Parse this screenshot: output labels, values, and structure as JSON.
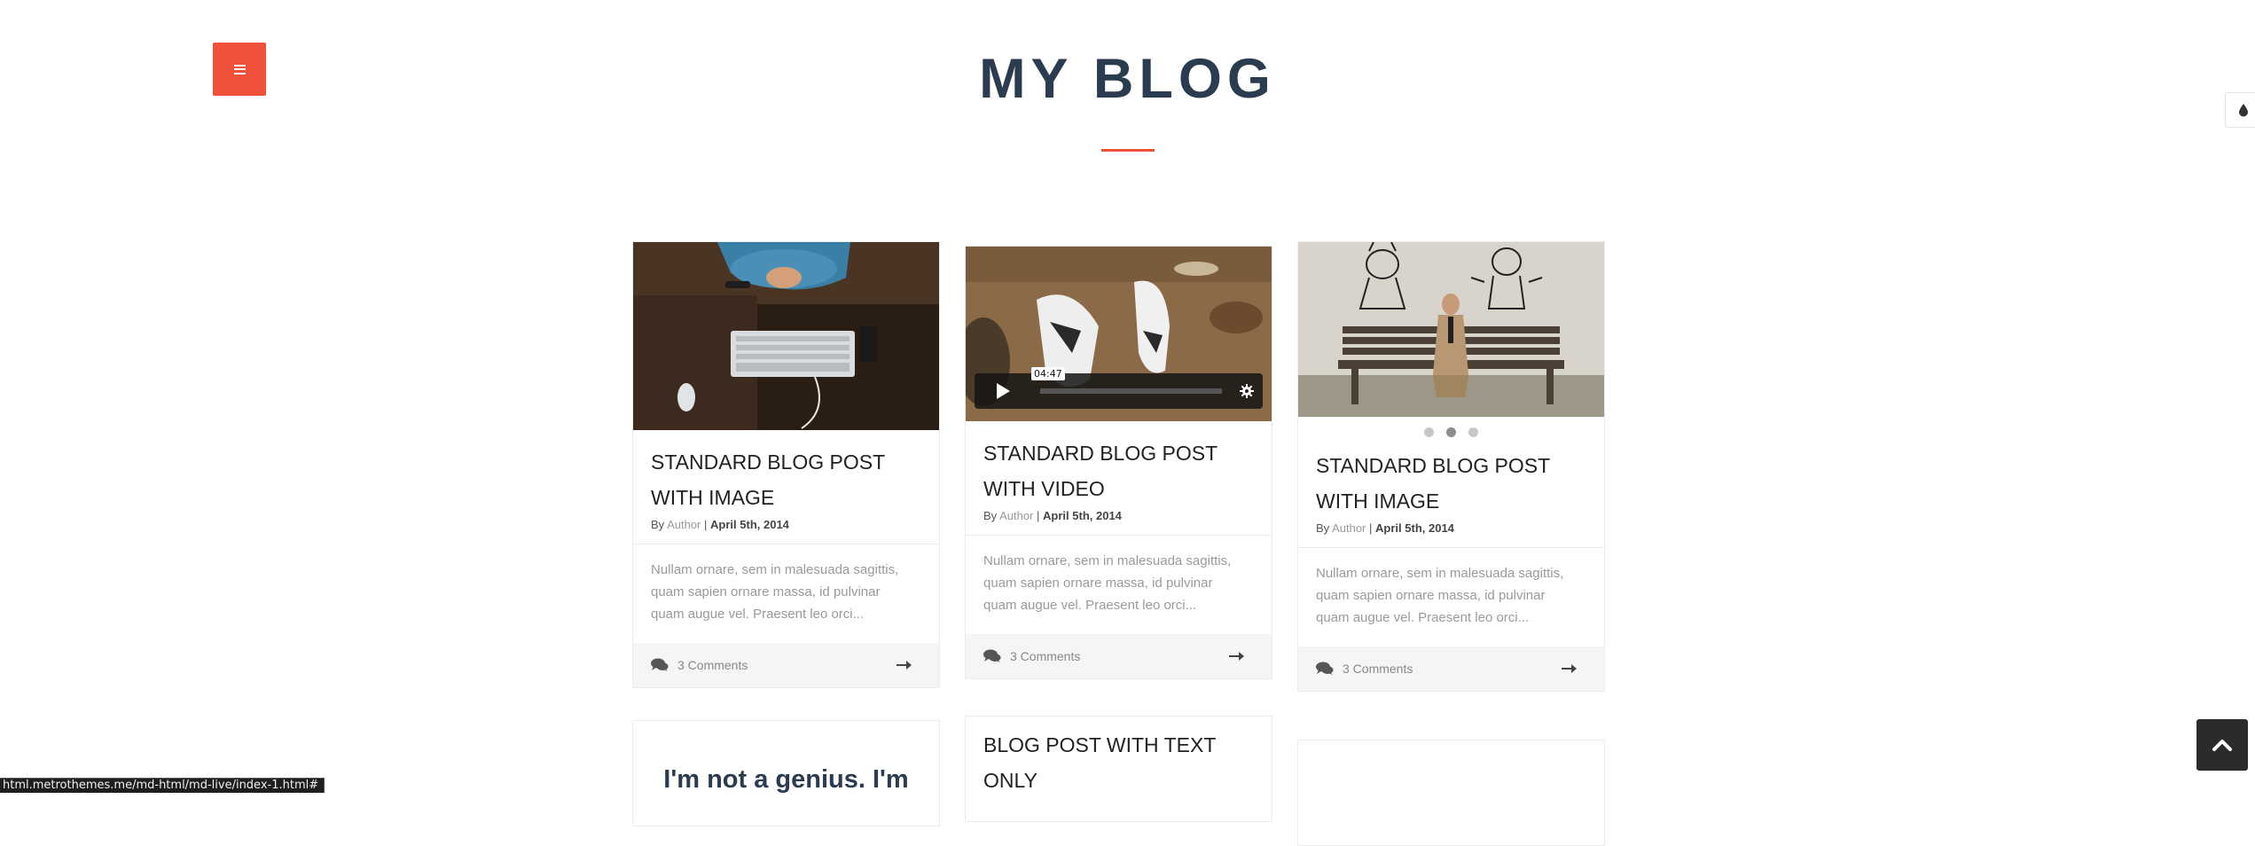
{
  "page": {
    "title": "MY BLOG"
  },
  "colors": {
    "accent": "#f0513a",
    "heading": "#2b3b50",
    "dark_button": "#2b2b2b"
  },
  "icons": {
    "menu": "hamburger-icon",
    "style_toggle": "droplet-icon",
    "comments": "comments-icon",
    "read_more": "arrow-right-icon",
    "back_to_top": "chevron-up-icon",
    "video_play": "play-icon",
    "video_settings": "gear-icon"
  },
  "posts": [
    {
      "title_line1": "STANDARD BLOG POST",
      "title_line2": "WITH IMAGE",
      "by": "By",
      "author": "Author",
      "separator": "|",
      "date": "April 5th, 2014",
      "excerpt_line1": "Nullam ornare, sem in malesuada sagittis,",
      "excerpt_line2": "quam sapien ornare massa, id pulvinar",
      "excerpt_line3": "quam augue vel. Praesent leo orci...",
      "comments": "3 Comments"
    },
    {
      "title_line1": "STANDARD BLOG POST",
      "title_line2": "WITH VIDEO",
      "by": "By",
      "author": "Author",
      "separator": "|",
      "date": "April 5th, 2014",
      "excerpt_line1": "Nullam ornare, sem in malesuada sagittis,",
      "excerpt_line2": "quam sapien ornare massa, id pulvinar",
      "excerpt_line3": "quam augue vel. Praesent leo orci...",
      "comments": "3 Comments",
      "video_time": "04:47"
    },
    {
      "title_line1": "STANDARD BLOG POST",
      "title_line2": "WITH IMAGE",
      "by": "By",
      "author": "Author",
      "separator": "|",
      "date": "April 5th, 2014",
      "excerpt_line1": "Nullam ornare, sem in malesuada sagittis,",
      "excerpt_line2": "quam sapien ornare massa, id pulvinar",
      "excerpt_line3": "quam augue vel. Praesent leo orci...",
      "comments": "3 Comments",
      "slider_active_dot": 2,
      "slider_dot_count": 3
    }
  ],
  "text_post": {
    "title_line1": "BLOG POST WITH TEXT",
    "title_line2": "ONLY"
  },
  "quote_post": {
    "text": "I'm not a genius. I'm"
  },
  "status_bar": {
    "url": "html.metrothemes.me/md-html/md-live/index-1.html#"
  }
}
